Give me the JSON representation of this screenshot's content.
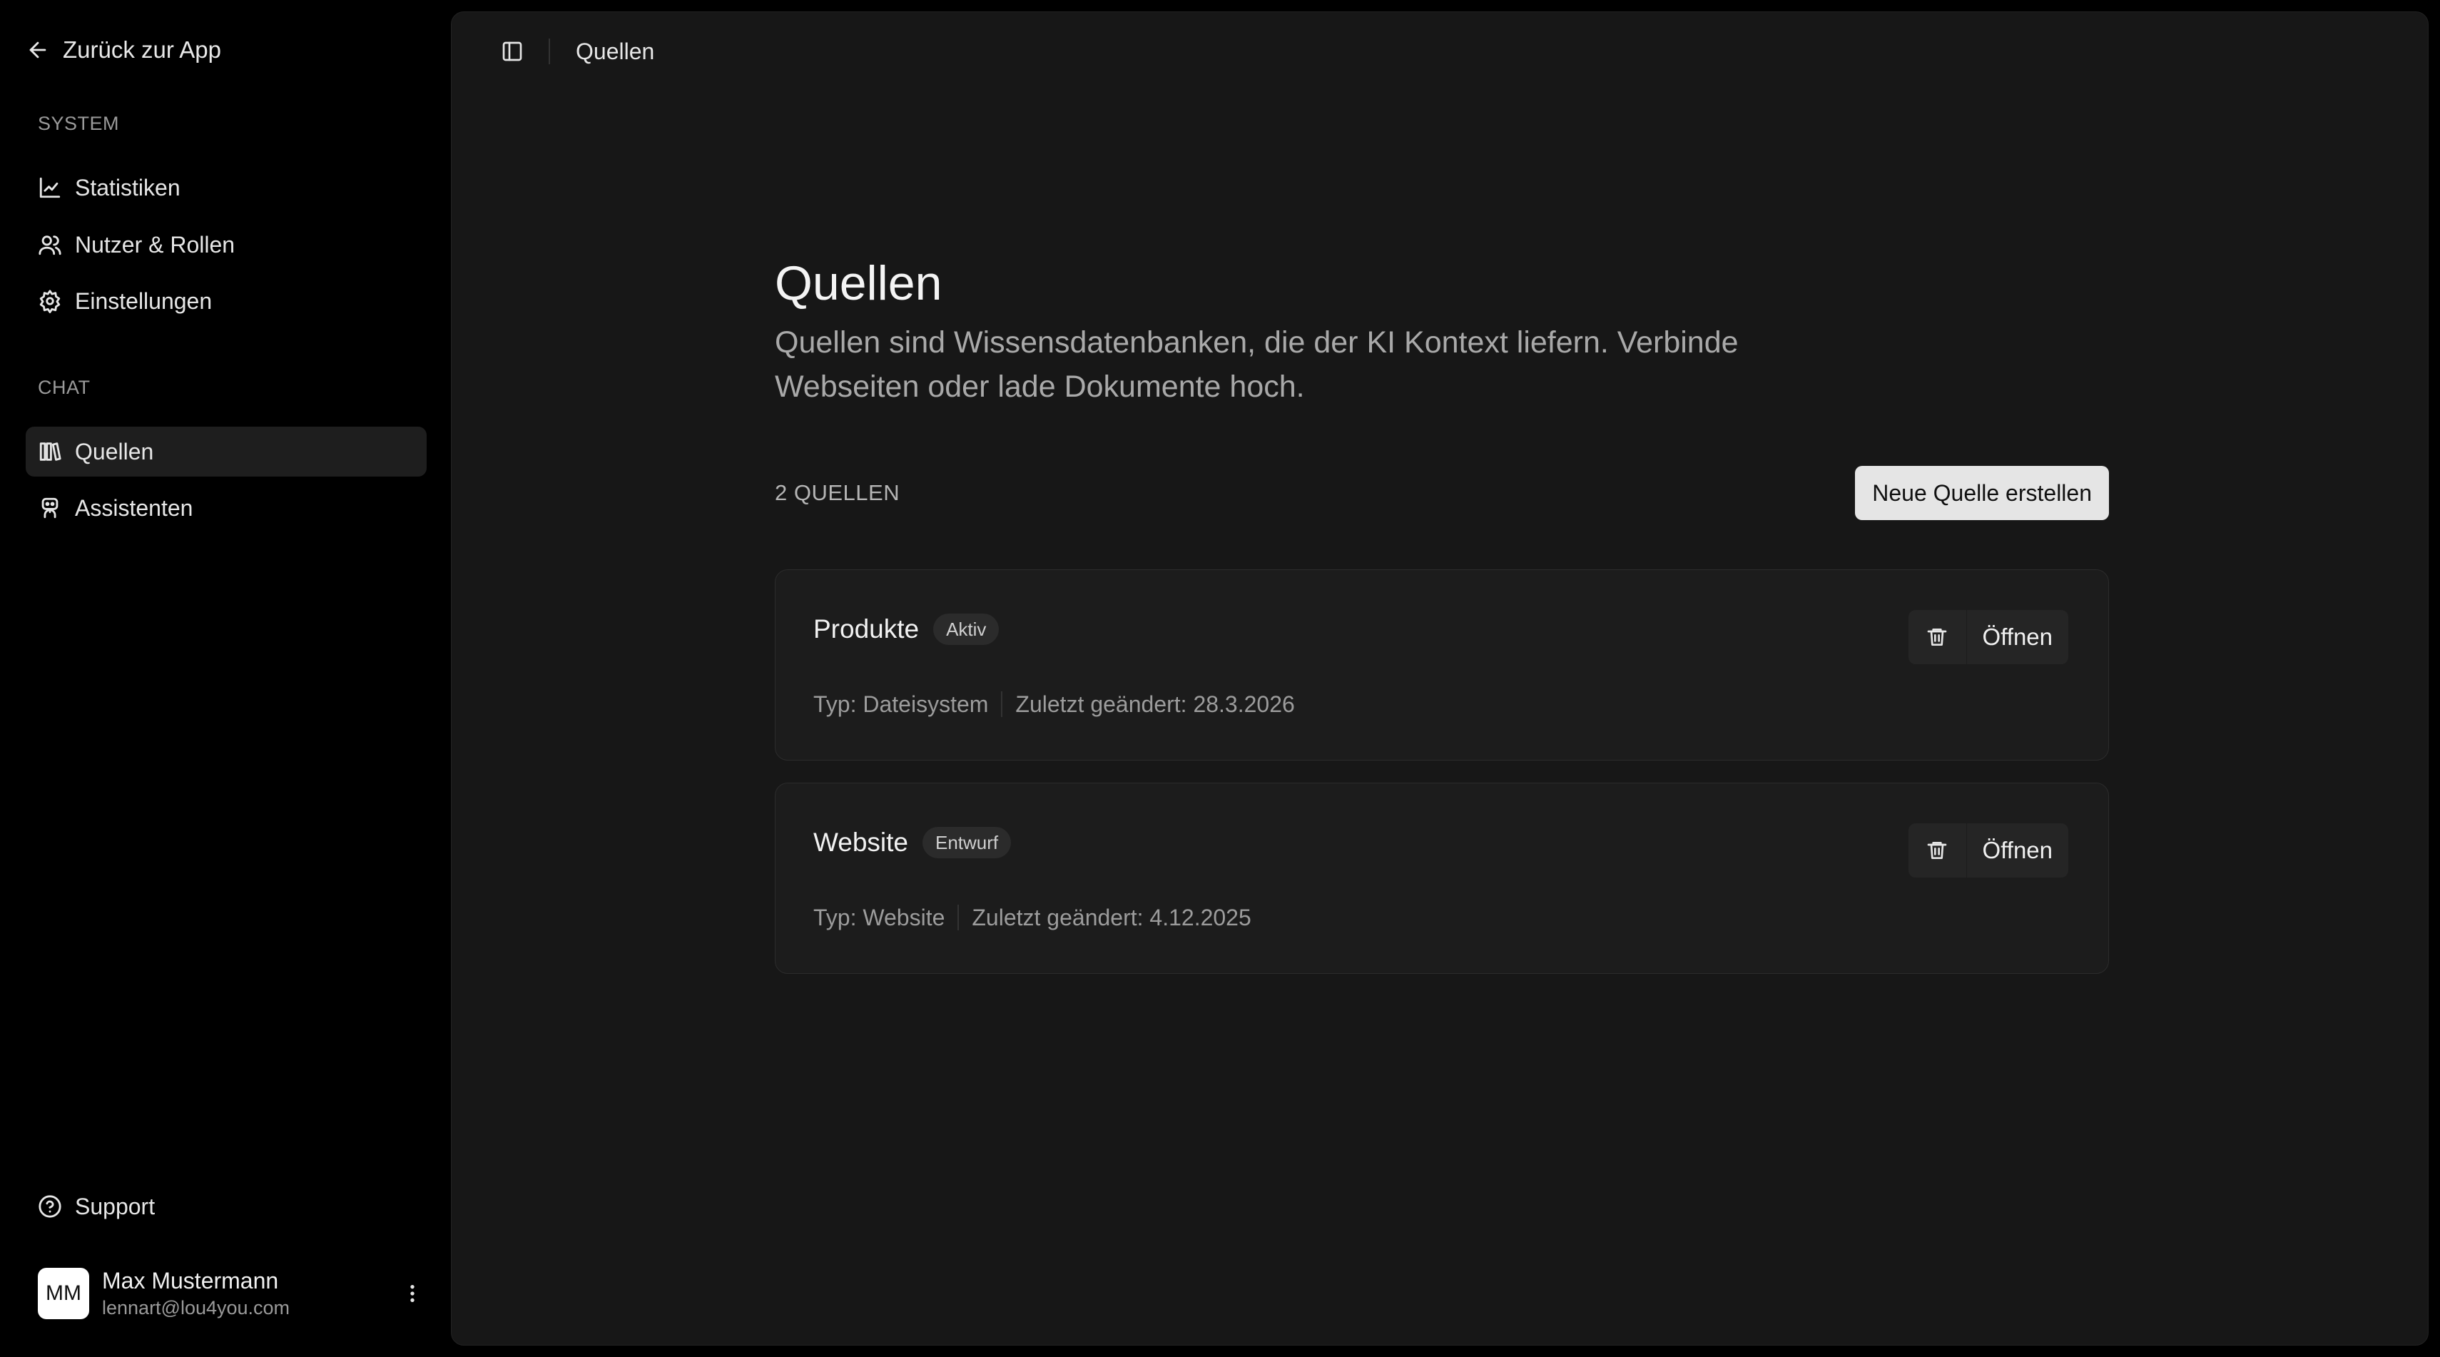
{
  "sidebar": {
    "back_label": "Zurück zur App",
    "sections": [
      {
        "label": "SYSTEM",
        "items": [
          {
            "label": "Statistiken",
            "icon": "chart-icon"
          },
          {
            "label": "Nutzer & Rollen",
            "icon": "users-icon"
          },
          {
            "label": "Einstellungen",
            "icon": "gear-icon"
          }
        ]
      },
      {
        "label": "CHAT",
        "items": [
          {
            "label": "Quellen",
            "icon": "library-icon",
            "active": true
          },
          {
            "label": "Assistenten",
            "icon": "bot-icon"
          }
        ]
      }
    ],
    "support_label": "Support",
    "user": {
      "initials": "MM",
      "name": "Max Mustermann",
      "email": "lennart@lou4you.com"
    }
  },
  "topbar": {
    "breadcrumb": "Quellen"
  },
  "main": {
    "title": "Quellen",
    "description": "Quellen sind Wissensdatenbanken, die der KI Kontext liefern. Verbinde Webseiten oder lade Dokumente hoch.",
    "count_label": "2 QUELLEN",
    "create_button": "Neue Quelle erstellen",
    "sources": [
      {
        "name": "Produkte",
        "status": "Aktiv",
        "type": "Typ: Dateisystem",
        "modified": "Zuletzt geändert: 28.3.2026",
        "open_label": "Öffnen"
      },
      {
        "name": "Website",
        "status": "Entwurf",
        "type": "Typ: Website",
        "modified": "Zuletzt geändert: 4.12.2025",
        "open_label": "Öffnen"
      }
    ]
  },
  "colors": {
    "background": "#000000",
    "panel": "#171717",
    "card": "#1c1c1c",
    "primary_button": "#e5e5e5",
    "active_nav": "#1e1e1e"
  }
}
